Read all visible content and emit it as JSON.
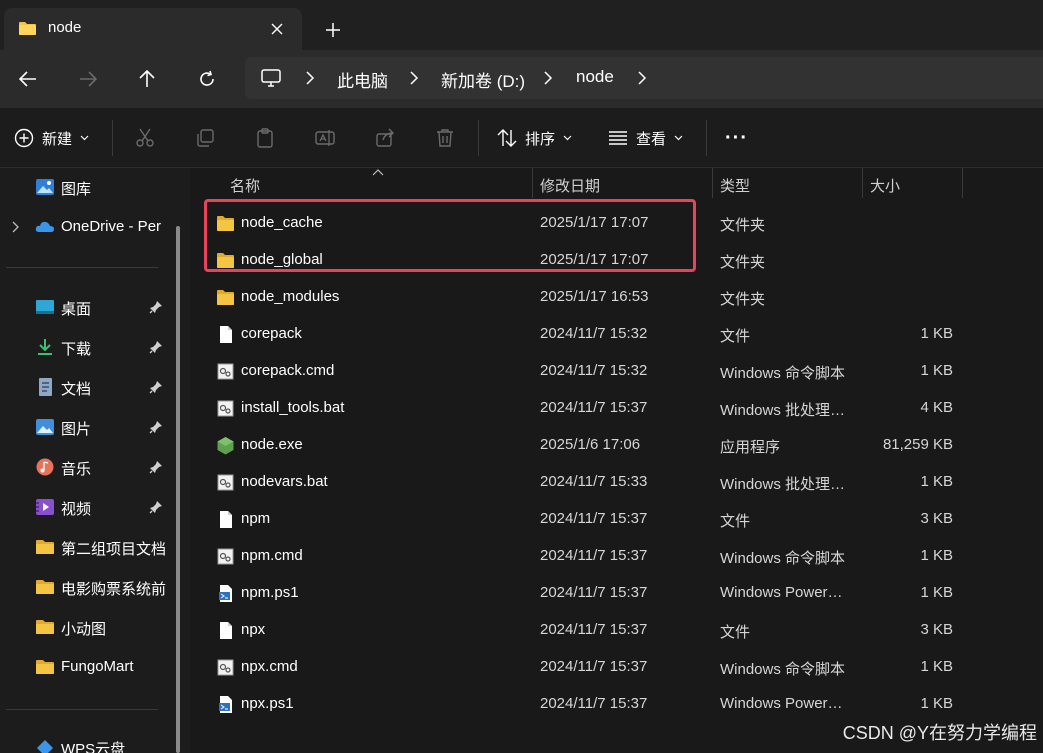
{
  "tab": {
    "title": "node"
  },
  "address": {
    "crumbs": [
      "此电脑",
      "新加卷 (D:)",
      "node"
    ]
  },
  "toolbar": {
    "new_label": "新建",
    "sort_label": "排序",
    "view_label": "查看",
    "more_label": "···"
  },
  "sidebar": {
    "top_items": [
      {
        "label": "图库",
        "icon": "gallery-icon"
      },
      {
        "label": "OneDrive - Per",
        "icon": "onedrive-icon"
      }
    ],
    "pinned": [
      {
        "label": "桌面",
        "icon": "desktop-icon"
      },
      {
        "label": "下载",
        "icon": "download-icon"
      },
      {
        "label": "文档",
        "icon": "document-icon"
      },
      {
        "label": "图片",
        "icon": "pictures-icon"
      },
      {
        "label": "音乐",
        "icon": "music-icon"
      },
      {
        "label": "视频",
        "icon": "video-icon"
      }
    ],
    "folders": [
      {
        "label": "第二组项目文档"
      },
      {
        "label": "电影购票系统前"
      },
      {
        "label": "小动图"
      },
      {
        "label": "FungoMart"
      }
    ],
    "bottom_item": {
      "label": "WPS云盘",
      "icon": "wps-cloud-icon"
    }
  },
  "columns": {
    "name": "名称",
    "date": "修改日期",
    "type": "类型",
    "size": "大小"
  },
  "files": [
    {
      "name": "node_cache",
      "date": "2025/1/17 17:07",
      "type": "文件夹",
      "size": "",
      "icon": "folder-icon"
    },
    {
      "name": "node_global",
      "date": "2025/1/17 17:07",
      "type": "文件夹",
      "size": "",
      "icon": "folder-icon"
    },
    {
      "name": "node_modules",
      "date": "2025/1/17 16:53",
      "type": "文件夹",
      "size": "",
      "icon": "folder-icon"
    },
    {
      "name": "corepack",
      "date": "2024/11/7 15:32",
      "type": "文件",
      "size": "1 KB",
      "icon": "file-icon"
    },
    {
      "name": "corepack.cmd",
      "date": "2024/11/7 15:32",
      "type": "Windows 命令脚本",
      "size": "1 KB",
      "icon": "script-icon"
    },
    {
      "name": "install_tools.bat",
      "date": "2024/11/7 15:37",
      "type": "Windows 批处理…",
      "size": "4 KB",
      "icon": "script-icon"
    },
    {
      "name": "node.exe",
      "date": "2025/1/6 17:06",
      "type": "应用程序",
      "size": "81,259 KB",
      "icon": "node-exe-icon"
    },
    {
      "name": "nodevars.bat",
      "date": "2024/11/7 15:33",
      "type": "Windows 批处理…",
      "size": "1 KB",
      "icon": "script-icon"
    },
    {
      "name": "npm",
      "date": "2024/11/7 15:37",
      "type": "文件",
      "size": "3 KB",
      "icon": "file-icon"
    },
    {
      "name": "npm.cmd",
      "date": "2024/11/7 15:37",
      "type": "Windows 命令脚本",
      "size": "1 KB",
      "icon": "script-icon"
    },
    {
      "name": "npm.ps1",
      "date": "2024/11/7 15:37",
      "type": "Windows Power…",
      "size": "1 KB",
      "icon": "powershell-icon"
    },
    {
      "name": "npx",
      "date": "2024/11/7 15:37",
      "type": "文件",
      "size": "3 KB",
      "icon": "file-icon"
    },
    {
      "name": "npx.cmd",
      "date": "2024/11/7 15:37",
      "type": "Windows 命令脚本",
      "size": "1 KB",
      "icon": "script-icon"
    },
    {
      "name": "npx.ps1",
      "date": "2024/11/7 15:37",
      "type": "Windows Power…",
      "size": "1 KB",
      "icon": "powershell-icon"
    }
  ],
  "watermark": "CSDN @Y在努力学编程",
  "colors": {
    "highlight": "#e8435a",
    "folder": "#f4c542",
    "accent": "#4cc2ff"
  }
}
